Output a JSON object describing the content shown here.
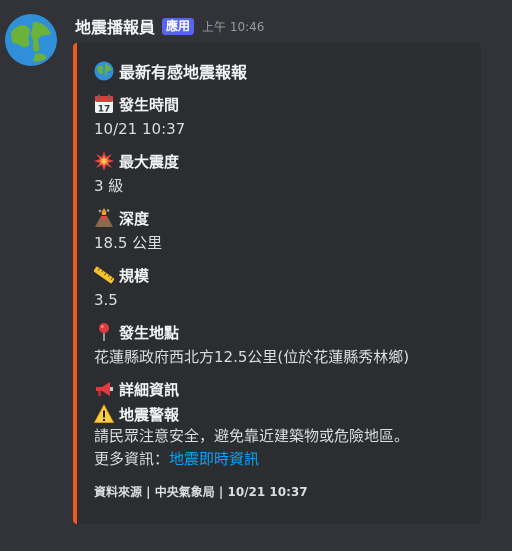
{
  "author": {
    "name": "地震播報員",
    "badge": "應用",
    "timestamp": "上午 10:46",
    "avatar_icon": "globe-emoji"
  },
  "embed": {
    "accent_color": "#f1591d",
    "title": "最新有感地震報報",
    "fields": [
      {
        "icon": "calendar-icon",
        "name": "發生時間",
        "value": "10/21 10:37"
      },
      {
        "icon": "collision-icon",
        "name": "最大震度",
        "value": "3 級"
      },
      {
        "icon": "volcano-icon",
        "name": "深度",
        "value": "18.5 公里"
      },
      {
        "icon": "ruler-icon",
        "name": "規模",
        "value": "3.5"
      },
      {
        "icon": "pin-icon",
        "name": "發生地點",
        "value": "花蓮縣政府西北方12.5公里(位於花蓮縣秀林鄉)"
      }
    ],
    "details": {
      "icon": "megaphone-icon",
      "name": "詳細資訊",
      "warning_icon": "warning-icon",
      "warning_title": "地震警報",
      "warning_text": "請民眾注意安全，避免靠近建築物或危險地區。",
      "more_label": "更多資訊：",
      "more_link": "地震即時資訊"
    },
    "footer": "資料來源 | 中央氣象局 | 10/21 10:37"
  }
}
